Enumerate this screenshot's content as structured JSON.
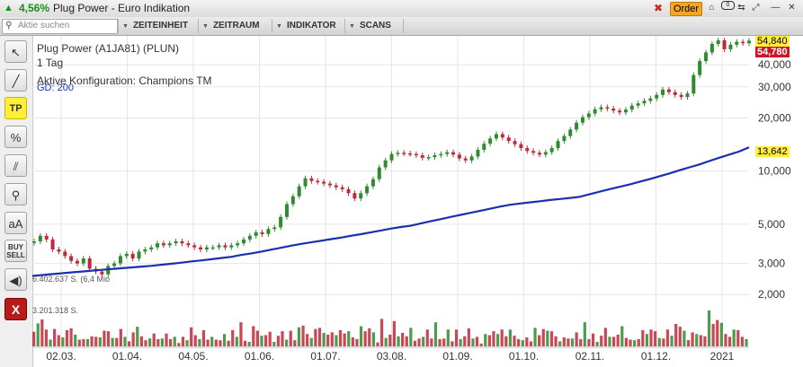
{
  "title_bar": {
    "change_pct": "4,56%",
    "instrument": "Plug Power - Euro Indikation",
    "order_button": "Order",
    "badge": "0"
  },
  "toolbar": {
    "search_placeholder": "Aktie suchen",
    "menus": [
      "ZEITEINHEIT",
      "ZEITRAUM",
      "INDIKATOR",
      "SCANS"
    ]
  },
  "sidebar": {
    "tp_label": "TP",
    "percent_label": "%",
    "aa_label": "aA",
    "buy_label": "BUY",
    "sell_label": "SELL",
    "close_label": "X"
  },
  "chart_info": {
    "name": "Plug Power (A1JA81) (PLUN)",
    "interval": "1 Tag",
    "config": "Aktive Konfiguration: Champions TM",
    "ma_label": "GD: 200",
    "volume_top_label": "6.402.637 S. (6,4 Mio",
    "volume_bottom_label": "3.201.318 S."
  },
  "price_tags": {
    "high": "54,840",
    "last": "54,780",
    "ma": "13,642"
  },
  "colors": {
    "up": "#2e8b2e",
    "down": "#c0283a",
    "ma": "#1a2fb0",
    "grid": "#e6e6e6"
  },
  "chart_data": {
    "type": "line",
    "scale": "log",
    "y_ticks": [
      "40,000",
      "30,000",
      "20,000",
      "10,000",
      "5,000",
      "3,000",
      "2,000"
    ],
    "y_tick_values": [
      40,
      30,
      20,
      10,
      5,
      3,
      2
    ],
    "x_ticks": [
      "02.03.",
      "01.04.",
      "04.05.",
      "01.06.",
      "01.07.",
      "03.08.",
      "01.09.",
      "01.10.",
      "02.11.",
      "01.12.",
      "2021"
    ],
    "price_series": {
      "name": "Plug Power",
      "values": [
        4.0,
        4.3,
        4.1,
        3.6,
        3.5,
        3.3,
        3.1,
        3.0,
        3.2,
        2.8,
        2.7,
        2.6,
        2.9,
        3.0,
        3.3,
        3.4,
        3.2,
        3.5,
        3.6,
        3.7,
        3.9,
        3.8,
        3.9,
        4.0,
        3.9,
        3.8,
        3.7,
        3.6,
        3.7,
        3.7,
        3.8,
        3.7,
        3.8,
        3.9,
        4.1,
        4.3,
        4.5,
        4.4,
        4.7,
        4.8,
        5.5,
        6.5,
        7.2,
        8.2,
        9.1,
        8.8,
        8.7,
        8.5,
        8.3,
        8.1,
        7.9,
        7.5,
        7.0,
        7.5,
        8.2,
        9.0,
        10.5,
        11.5,
        12.5,
        12.7,
        12.6,
        12.5,
        12.3,
        11.9,
        12.0,
        12.3,
        12.5,
        12.8,
        12.4,
        11.8,
        11.5,
        12.1,
        13.2,
        14.3,
        15.3,
        16.2,
        15.5,
        14.8,
        14.2,
        13.5,
        13.0,
        12.7,
        12.4,
        12.8,
        13.5,
        14.8,
        15.8,
        17.2,
        18.8,
        20.2,
        21.2,
        22.4,
        23.0,
        22.6,
        22.0,
        21.5,
        22.3,
        23.5,
        24.2,
        25.0,
        25.8,
        27.0,
        29.0,
        28.0,
        27.0,
        26.3,
        27.5,
        35.0,
        42.0,
        47.0,
        52.5,
        55.0,
        49.0,
        52.0,
        54.0,
        53.0,
        54.78
      ]
    },
    "ma_series": {
      "name": "GD: 200",
      "values": [
        2.55,
        2.58,
        2.61,
        2.64,
        2.67,
        2.7,
        2.73,
        2.76,
        2.79,
        2.82,
        2.85,
        2.88,
        2.91,
        2.95,
        2.99,
        3.03,
        3.08,
        3.12,
        3.17,
        3.22,
        3.27,
        3.35,
        3.42,
        3.5,
        3.59,
        3.68,
        3.78,
        3.87,
        3.95,
        4.03,
        4.12,
        4.2,
        4.3,
        4.39,
        4.5,
        4.61,
        4.72,
        4.82,
        4.9,
        5.05,
        5.2,
        5.34,
        5.5,
        5.65,
        5.8,
        5.96,
        6.12,
        6.3,
        6.45,
        6.55,
        6.65,
        6.75,
        6.86,
        6.95,
        7.05,
        7.15,
        7.4,
        7.65,
        7.9,
        8.15,
        8.4,
        8.7,
        9.0,
        9.35,
        9.7,
        10.1,
        10.5,
        10.9,
        11.4,
        11.9,
        12.4,
        12.9,
        13.64
      ]
    },
    "volume": {
      "values": [
        2.6,
        4.1,
        4.8,
        3.0,
        1.2,
        3.1,
        2.0,
        1.6,
        2.9,
        3.2,
        2.1,
        1.2,
        1.3,
        1.3,
        1.8,
        1.7,
        1.6,
        2.8,
        2.7,
        1.5,
        1.5,
        3.1,
        1.7,
        0.9,
        2.5,
        3.5,
        1.8,
        1.1,
        1.4,
        2.3,
        1.3,
        1.4,
        2.3,
        1.3,
        1.7,
        0.6,
        1.7,
        1.1,
        3.4,
        2.0,
        1.3,
        2.9,
        1.2,
        1.7,
        1.2,
        1.1,
        2.2,
        1.0,
        2.9,
        1.7,
        4.3,
        1.0,
        0.8,
        3.6,
        2.8,
        1.9,
        2.0,
        2.6,
        0.8,
        1.9,
        2.7,
        1.2,
        2.8,
        1.1,
        3.4,
        3.7,
        2.2,
        1.5,
        3.1,
        3.3,
        2.4,
        2.1,
        2.5,
        2.0,
        2.9,
        2.3,
        2.7,
        1.6,
        1.3,
        3.6,
        2.7,
        3.2,
        2.5,
        0.7,
        4.9,
        1.5,
        2.1,
        4.5,
        1.8,
        2.4,
        1.8,
        3.3,
        1.0,
        1.4,
        1.7,
        3.0,
        1.4,
        4.3,
        1.3,
        1.4,
        3.0,
        0.9,
        3.0,
        1.3,
        1.8,
        3.2,
        1.4,
        1.7,
        0.5,
        2.2,
        2.0,
        2.7,
        2.2,
        3.0,
        1.8,
        3.0,
        1.9,
        1.3,
        1.1,
        1.6,
        0.9,
        3.3,
        2.0,
        3.1,
        2.8,
        2.7,
        1.8,
        0.9,
        1.6,
        1.4,
        1.4,
        2.5,
        1.3,
        4.3,
        1.3,
        2.3,
        0.8,
        1.9,
        3.3,
        1.7,
        1.7,
        2.1,
        3.6,
        1.5,
        1.2,
        1.1,
        1.3,
        2.9,
        2.2,
        3.0,
        2.7,
        1.5,
        1.4,
        3.0,
        1.9,
        4.0,
        3.5,
        2.8,
        1.1,
        2.5,
        2.2,
        2.0,
        1.8,
        6.4,
        4.0,
        4.7,
        4.2,
        2.2,
        1.7,
        3.0,
        2.9,
        1.7,
        1.3
      ],
      "unit": "Mio S."
    }
  }
}
